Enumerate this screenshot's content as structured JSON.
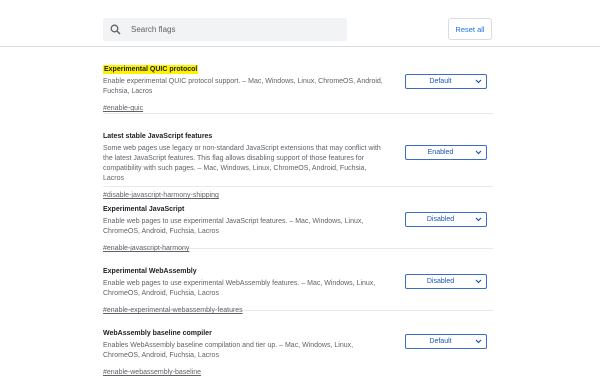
{
  "search": {
    "placeholder": "Search flags"
  },
  "header": {
    "reset_label": "Reset all"
  },
  "flags": [
    {
      "title": "Experimental QUIC protocol",
      "description": "Enable experimental QUIC protocol support. – Mac, Windows, Linux, ChromeOS, Android, Fuchsia, Lacros",
      "link": "#enable-quic",
      "value": "Default",
      "highlighted": true
    },
    {
      "title": "Latest stable JavaScript features",
      "description": "Some web pages use legacy or non-standard JavaScript extensions that may conflict with the latest JavaScript features. This flag allows disabling support of those features for compatibility with such pages. – Mac, Windows, Linux, ChromeOS, Android, Fuchsia, Lacros",
      "link": "#disable-javascript-harmony-shipping",
      "value": "Enabled"
    },
    {
      "title": "Experimental JavaScript",
      "description": "Enable web pages to use experimental JavaScript features. – Mac, Windows, Linux, ChromeOS, Android, Fuchsia, Lacros",
      "link": "#enable-javascript-harmony",
      "value": "Disabled"
    },
    {
      "title": "Experimental WebAssembly",
      "description": "Enable web pages to use experimental WebAssembly features. – Mac, Windows, Linux, ChromeOS, Android, Fuchsia, Lacros",
      "link": "#enable-experimental-webassembly-features",
      "value": "Disabled"
    },
    {
      "title": "WebAssembly baseline compiler",
      "description": "Enables WebAssembly baseline compilation and tier up. – Mac, Windows, Linux, ChromeOS, Android, Fuchsia, Lacros",
      "link": "#enable-webassembly-baseline",
      "value": "Default"
    }
  ],
  "colors": {
    "accent": "#1a73e8",
    "highlight": "#fff200",
    "select_border": "#3c6cc8"
  }
}
